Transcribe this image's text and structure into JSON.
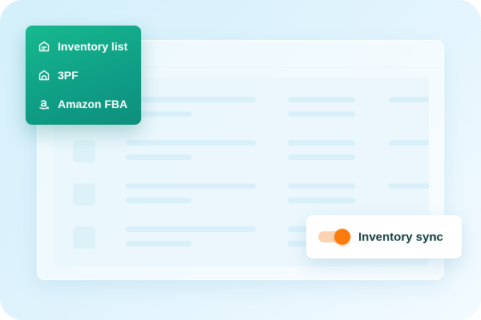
{
  "menu": {
    "items": [
      {
        "label": "Inventory list",
        "icon": "inventory-list-icon"
      },
      {
        "label": "3PF",
        "icon": "warehouse-icon"
      },
      {
        "label": "Amazon FBA",
        "icon": "amazon-icon"
      }
    ],
    "colors": {
      "background": "#12a98a",
      "text": "#ffffff"
    }
  },
  "sync": {
    "label": "Inventory sync",
    "enabled": true,
    "colors": {
      "knob": "#fb7b0c",
      "track": "#fbd3b3",
      "text": "#0c3b3a"
    }
  },
  "background": {
    "color": "#d8f1fb"
  }
}
